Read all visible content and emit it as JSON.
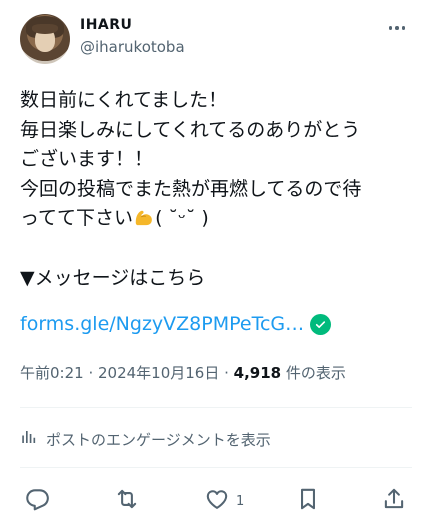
{
  "author": {
    "display_name": "IHARU",
    "handle": "@iharukotoba"
  },
  "tweet": {
    "lines": [
      "数日前にくれてました！",
      "毎日楽しみにしてくれてるのありがとう",
      "ございます！！",
      "今回の投稿でまた熱が再燃してるので待",
      "ってて下さい",
      "",
      "▼メッセージはこちら"
    ],
    "line5_suffix": "( ˘ᵕ˘ )",
    "emoji": "flexed-biceps-emoji",
    "link_text": "forms.gle/NgzyVZ8PMPeTcG…",
    "link_badge_icon": "check-circle-icon"
  },
  "meta": {
    "time": "午前0:21",
    "sep1": " · ",
    "date": "2024年10月16日",
    "sep2": " · ",
    "views_count": "4,918",
    "views_label": " 件の表示"
  },
  "engagement_link": "ポストのエンゲージメントを表示",
  "actions": {
    "reply_icon": "reply-icon",
    "repost_icon": "repost-icon",
    "like_icon": "heart-icon",
    "like_count": "1",
    "bookmark_icon": "bookmark-icon",
    "share_icon": "share-icon"
  },
  "colors": {
    "text": "#0f1419",
    "secondary": "#536471",
    "link": "#1d9bf0",
    "verified": "#00ba7c",
    "divider": "#eff3f4",
    "emoji": "#f5b72a"
  }
}
